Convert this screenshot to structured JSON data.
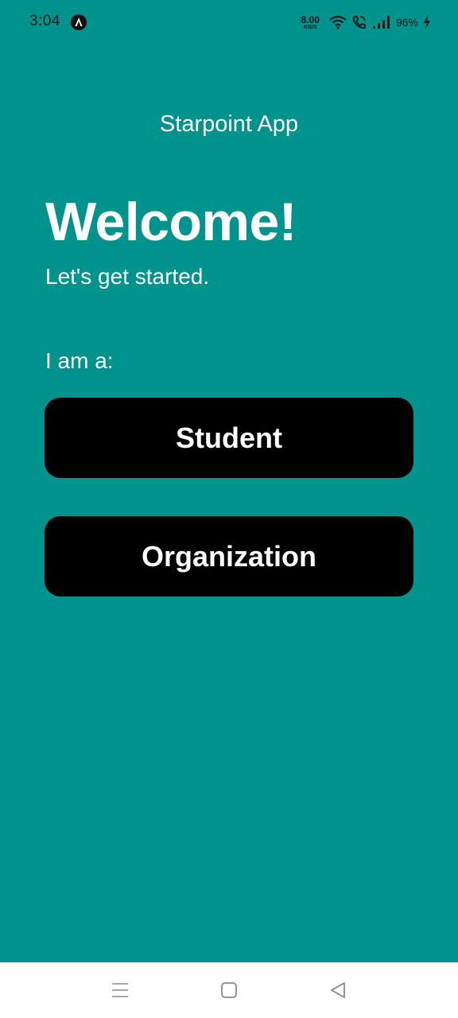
{
  "status_bar": {
    "time": "3:04",
    "net_speed_value": "8.00",
    "net_speed_unit": "KB/S",
    "battery": "96%",
    "icons": [
      "app-notification-icon",
      "wifi-icon",
      "wifi-call-icon",
      "signal-icon",
      "charging-icon"
    ]
  },
  "app": {
    "title": "Starpoint App",
    "welcome": "Welcome!",
    "subtitle": "Let's get started.",
    "role_prompt": "I am a:",
    "buttons": {
      "student": "Student",
      "organization": "Organization"
    }
  },
  "nav_bar": {
    "icons": [
      "menu-icon",
      "home-icon",
      "back-icon"
    ]
  },
  "colors": {
    "background": "#00928d",
    "button": "#000000",
    "text": "#ffffff",
    "nav_bar": "#ffffff"
  }
}
